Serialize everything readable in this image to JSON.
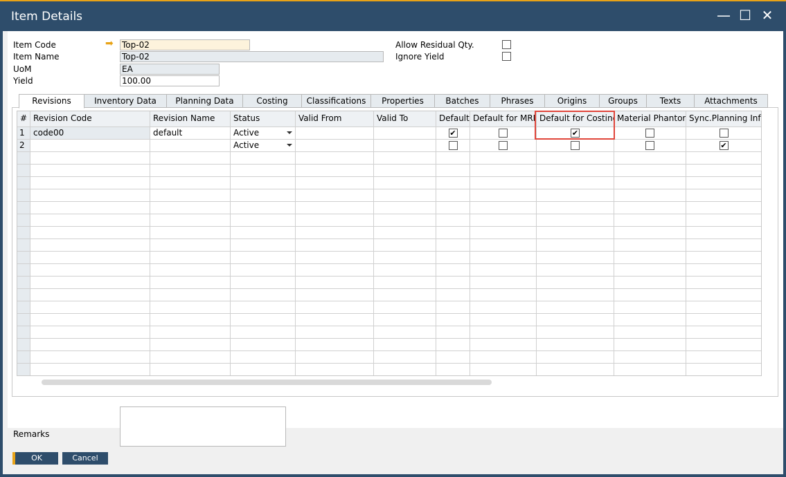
{
  "window": {
    "title": "Item Details",
    "minimize": "—",
    "maximize": "☐",
    "close": "✕"
  },
  "header": {
    "item_code_label": "Item Code",
    "item_code": "Top-02",
    "item_name_label": "Item Name",
    "item_name": "Top-02",
    "uom_label": "UoM",
    "uom": "EA",
    "yield_label": "Yield",
    "yield": "100.00",
    "allow_residual_label": "Allow Residual Qty.",
    "allow_residual": false,
    "ignore_yield_label": "Ignore Yield",
    "ignore_yield": false
  },
  "tabs": [
    "Revisions",
    "Inventory Data",
    "Planning Data",
    "Costing",
    "Classifications",
    "Properties",
    "Batches",
    "Phrases",
    "Origins",
    "Groups",
    "Texts",
    "Attachments"
  ],
  "active_tab": "Revisions",
  "grid": {
    "columns": [
      "#",
      "Revision Code",
      "Revision Name",
      "Status",
      "Valid From",
      "Valid To",
      "Default",
      "Default for MRP",
      "Default for Costing",
      "Material Phantom",
      "Sync.Planning Info"
    ],
    "rows": [
      {
        "num": "1",
        "code": "code00",
        "name": "default",
        "status": "Active",
        "valid_from": "",
        "valid_to": "",
        "default": true,
        "default_mrp": false,
        "default_costing": true,
        "material_phantom": false,
        "sync_planning": false
      },
      {
        "num": "2",
        "code": "",
        "name": "",
        "status": "Active",
        "valid_from": "",
        "valid_to": "",
        "default": false,
        "default_mrp": false,
        "default_costing": false,
        "material_phantom": false,
        "sync_planning": true
      }
    ]
  },
  "footer": {
    "remarks_label": "Remarks",
    "remarks": "",
    "ok": "OK",
    "cancel": "Cancel"
  },
  "colors": {
    "titlebar": "#2e4d6b",
    "accent": "#e8a317",
    "highlight": "#e0453a"
  }
}
